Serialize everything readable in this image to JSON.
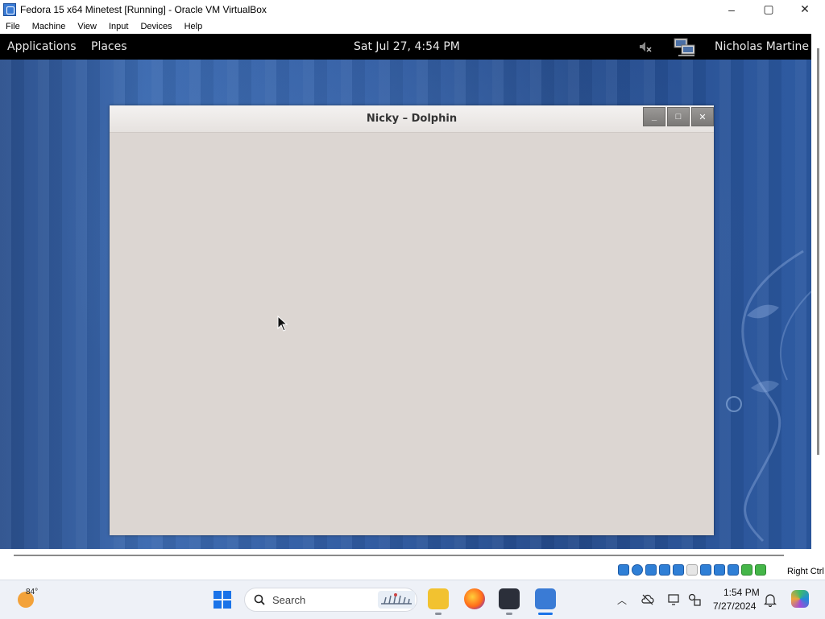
{
  "host_window": {
    "title": "Fedora 15 x64 Minetest [Running] - Oracle VM VirtualBox",
    "menu": [
      "File",
      "Machine",
      "View",
      "Input",
      "Devices",
      "Help"
    ],
    "controls": {
      "minimize": "–",
      "maximize": "▢",
      "close": "✕"
    }
  },
  "guest_panel": {
    "applications": "Applications",
    "places": "Places",
    "clock": "Sat Jul 27,  4:54 PM",
    "user": "Nicholas Martine"
  },
  "dolphin_window": {
    "title": "Nicky – Dolphin",
    "buttons": {
      "minimize": "_",
      "maximize": "□",
      "close": "✕"
    },
    "background": "#dcd6d2"
  },
  "vb_status": {
    "host_key": "Right Ctrl"
  },
  "taskbar": {
    "weather_temp": "84°",
    "search_placeholder": "Search",
    "time": "1:54 PM",
    "date": "7/27/2024"
  },
  "colors": {
    "desktop_blue": "#2f5aa0",
    "panel": "#000000",
    "accent": "#1a73e8"
  }
}
